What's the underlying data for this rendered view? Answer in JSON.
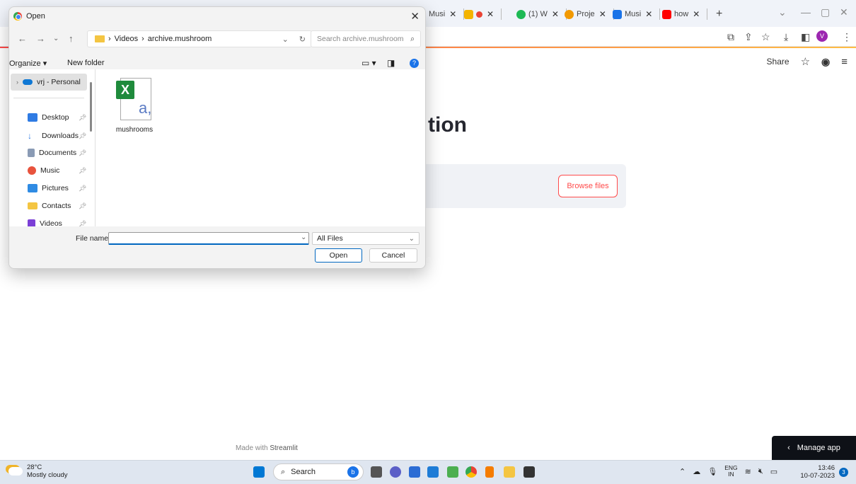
{
  "browser": {
    "tabs": [
      {
        "label": "Musi",
        "color": "#ff4b4b"
      },
      {
        "label": "",
        "color": "#2e7d32"
      },
      {
        "label": "(1) W",
        "color": "#1db954"
      },
      {
        "label": "Proje",
        "color": "#f29900"
      },
      {
        "label": "Musi",
        "color": "#1a73e8"
      },
      {
        "label": "how",
        "color": "#ff0000"
      }
    ],
    "new_tab": "+",
    "avatar_initial": "V"
  },
  "streamlit": {
    "share_label": "Share",
    "title_fragment": "tion",
    "browse_label": "Browse files",
    "made_with_prefix": "Made with",
    "made_with_brand": "Streamlit",
    "manage_app_label": "Manage app"
  },
  "dialog": {
    "title": "Open",
    "breadcrumb": [
      "Videos",
      "archive.mushroom"
    ],
    "search_placeholder": "Search archive.mushroom",
    "organize_label": "Organize",
    "new_folder_label": "New folder",
    "nav_top": "vrj - Personal",
    "nav_items": [
      {
        "label": "Desktop",
        "color": "#2f7be3"
      },
      {
        "label": "Downloads",
        "color": "#2f7be3"
      },
      {
        "label": "Documents",
        "color": "#8a9bb5"
      },
      {
        "label": "Music",
        "color": "#e8533d"
      },
      {
        "label": "Pictures",
        "color": "#2f8be3"
      },
      {
        "label": "Contacts",
        "color": "#f4c542"
      },
      {
        "label": "Videos",
        "color": "#7b3fd6"
      }
    ],
    "files": [
      {
        "name": "mushrooms",
        "type": "excel-csv-icon"
      }
    ],
    "file_name_label": "File name:",
    "file_name_value": "",
    "filter_value": "All Files",
    "open_label": "Open",
    "cancel_label": "Cancel"
  },
  "taskbar": {
    "temperature": "28°C",
    "weather": "Mostly cloudy",
    "search_label": "Search",
    "lang_top": "ENG",
    "lang_bottom": "IN",
    "time": "13:46",
    "date": "10-07-2023",
    "notification_count": "3"
  }
}
